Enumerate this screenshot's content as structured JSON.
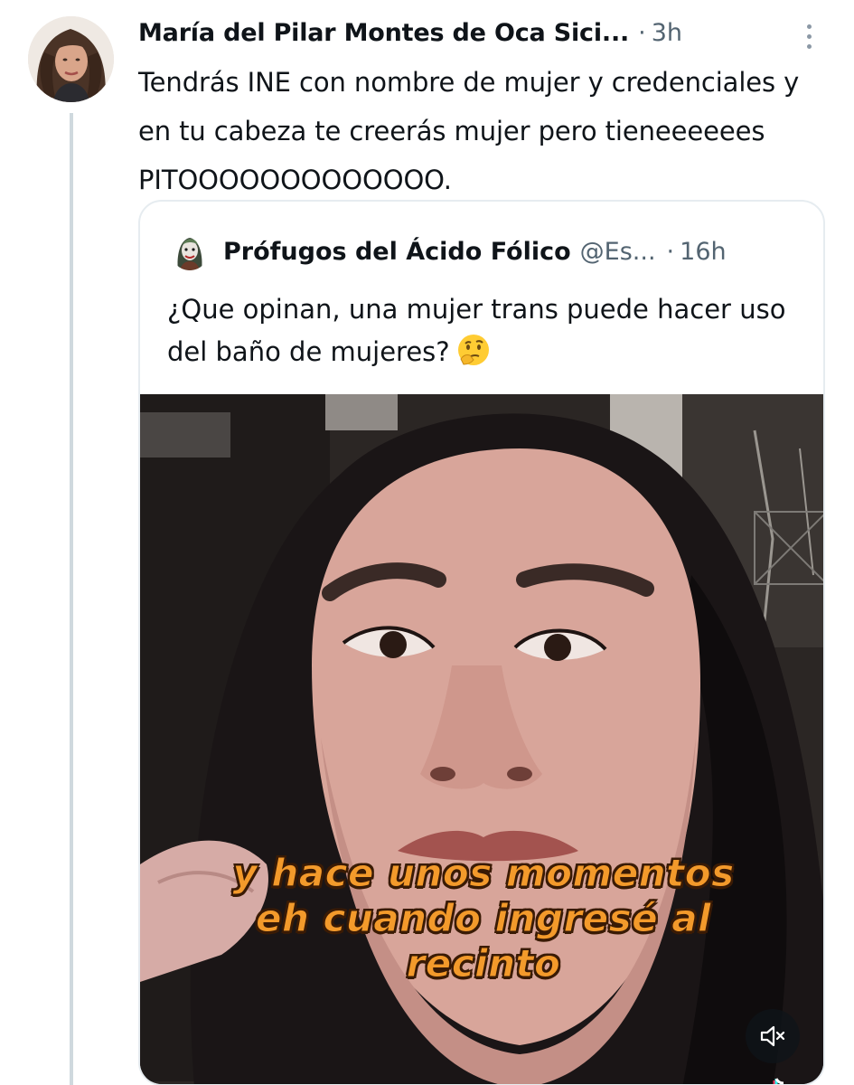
{
  "tweet": {
    "author_name": "María del Pilar Montes de Oca Sici...",
    "separator": "·",
    "time": "3h",
    "text": "Tendrás INE con nombre de mujer y credenciales y en tu cabeza te creerás mujer pero tieneeeeees PITOOOOOOOOOOOOO."
  },
  "quoted_tweet": {
    "author_name": "Prófugos del Ácido Fólico",
    "handle": "@Es...",
    "separator": "·",
    "time": "16h",
    "text": "¿Que opinan, una mujer trans puede hacer uso  del baño de mujeres?",
    "emoji": "thinking-face-icon",
    "media": {
      "caption_lines": [
        "y hace unos momentos",
        "eh cuando ingresé al",
        "recinto"
      ],
      "caption_color": "#f39a2b",
      "mute_icon": "speaker-muted-icon"
    }
  },
  "colors": {
    "primary_text": "#0f1419",
    "secondary_text": "#536471",
    "thread_line": "#cfd9de",
    "card_border": "#e6ecf0"
  }
}
